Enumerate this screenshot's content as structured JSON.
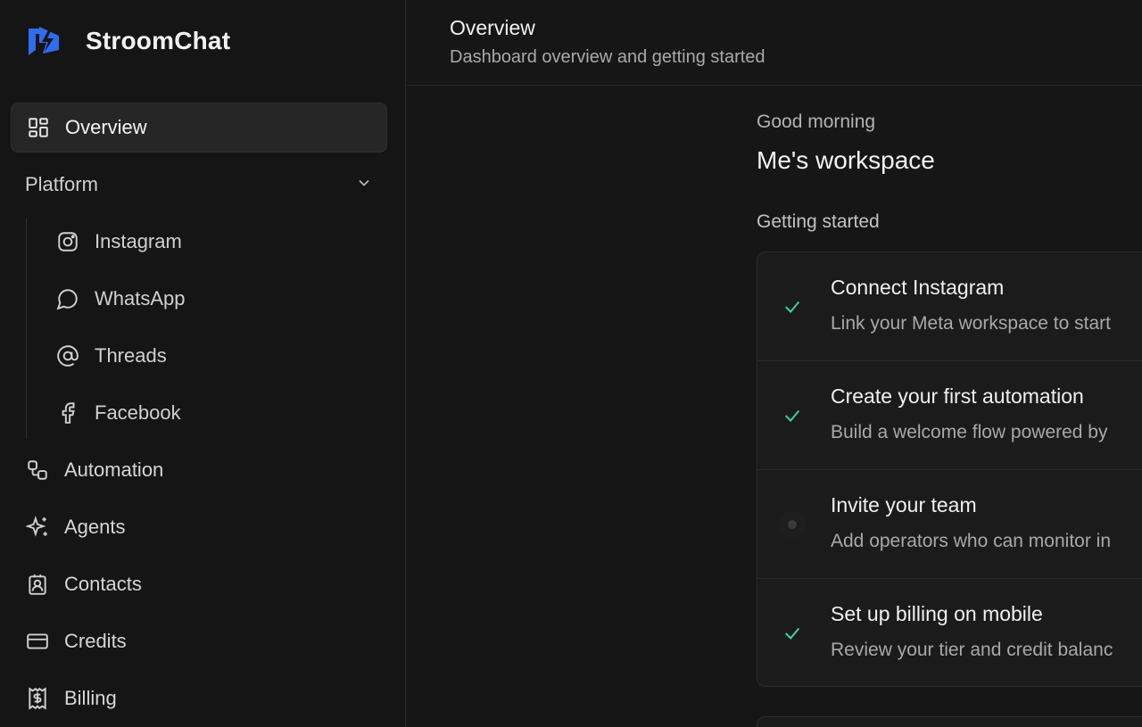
{
  "brand": {
    "name": "StroomChat",
    "logo_color": "#2f6cf0"
  },
  "sidebar": {
    "overview": {
      "label": "Overview",
      "icon": "layout-grid-icon"
    },
    "platform": {
      "label": "Platform",
      "expanded": true,
      "items": [
        {
          "label": "Instagram",
          "icon": "instagram-icon"
        },
        {
          "label": "WhatsApp",
          "icon": "chat-bubble-icon"
        },
        {
          "label": "Threads",
          "icon": "at-sign-icon"
        },
        {
          "label": "Facebook",
          "icon": "facebook-icon"
        }
      ]
    },
    "items": [
      {
        "label": "Automation",
        "icon": "workflow-icon"
      },
      {
        "label": "Agents",
        "icon": "sparkles-icon"
      },
      {
        "label": "Contacts",
        "icon": "contact-card-icon"
      },
      {
        "label": "Credits",
        "icon": "credit-card-icon"
      },
      {
        "label": "Billing",
        "icon": "receipt-dollar-icon"
      }
    ]
  },
  "header": {
    "title": "Overview",
    "subtitle": "Dashboard overview and getting started"
  },
  "main": {
    "greeting": "Good morning",
    "workspace": "Me's workspace",
    "getting_started": {
      "title": "Getting started",
      "steps": [
        {
          "title": "Connect Instagram",
          "description": "Link your Meta workspace to start",
          "done": true
        },
        {
          "title": "Create your first automation",
          "description": "Build a welcome flow powered by",
          "done": true
        },
        {
          "title": "Invite your team",
          "description": "Add operators who can monitor in",
          "done": false
        },
        {
          "title": "Set up billing on mobile",
          "description": "Review your tier and credit balanc",
          "done": true
        }
      ]
    }
  },
  "colors": {
    "check": "#3fd19a",
    "accent": "#2f6cf0",
    "pending_dot": "#3a3a3a"
  }
}
